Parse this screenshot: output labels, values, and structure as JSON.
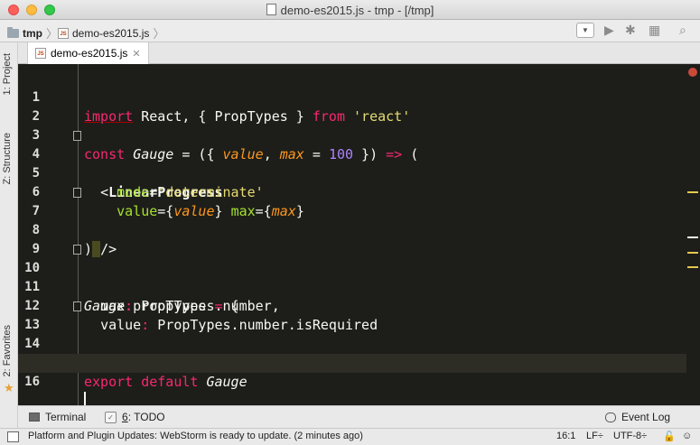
{
  "window": {
    "title": "demo-es2015.js - tmp - [/tmp]"
  },
  "breadcrumbs": [
    {
      "label": "tmp"
    },
    {
      "label": "demo-es2015.js"
    }
  ],
  "editor_tabs": [
    {
      "label": "demo-es2015.js",
      "active": true
    }
  ],
  "sidebar": {
    "tabs": [
      "1: Project",
      "Z: Structure",
      "2: Favorites"
    ]
  },
  "toolbar": {
    "icons": [
      "dropdown-icon",
      "run-icon",
      "debug-icon",
      "coverage-icon",
      "search-icon"
    ]
  },
  "editor": {
    "lines": [
      {
        "num": "1"
      },
      {
        "num": "2"
      },
      {
        "num": "3"
      },
      {
        "num": "4"
      },
      {
        "num": "5"
      },
      {
        "num": "6"
      },
      {
        "num": "7"
      },
      {
        "num": "8"
      },
      {
        "num": "9"
      },
      {
        "num": "10"
      },
      {
        "num": "11"
      },
      {
        "num": "12"
      },
      {
        "num": "13"
      },
      {
        "num": "14"
      },
      {
        "num": "15"
      },
      {
        "num": "16"
      }
    ],
    "code": {
      "l1_import": "import",
      "l1_rest": " React, { PropTypes } ",
      "l1_from": "from",
      "l1_str": "'react'",
      "l3_const": "const",
      "l3_name": "Gauge",
      "l3_eq": " = ({ ",
      "l3_value": "value",
      "l3_comma": ", ",
      "l3_max": "max",
      "l3_eq2": " = ",
      "l3_num": "100",
      "l3_end": " }) ",
      "l3_arrow": "=>",
      "l3_paren": " (",
      "l4_open": "<",
      "l4_tag": "LinearProgress",
      "l5_attr": "mode",
      "l5_eq": "=",
      "l5_str": "'determinate'",
      "l6_attr": "value",
      "l6_open": "={",
      "l6_val": "value",
      "l6_close": "} ",
      "l6_attr2": "max",
      "l6_open2": "={",
      "l6_val2": "max",
      "l6_close2": "}",
      "l7": "/>",
      "l8": ")",
      "l10_name": "Gauge",
      "l10_rest": ".propTypes ",
      "l10_eq": "=",
      "l10_brace": " {",
      "l11_key": "max",
      "l11_colon": ": ",
      "l11_val": "PropTypes.number,",
      "l12_key": "value",
      "l12_colon": ": ",
      "l12_val": "PropTypes.number.isRequired",
      "l13": "}",
      "l15_export": "export",
      "l15_default": "default",
      "l15_name": "Gauge"
    }
  },
  "toolwindows": {
    "terminal": "Terminal",
    "todo_num": "6",
    "todo_label": ": TODO",
    "event_log": "Event Log"
  },
  "status": {
    "message": "Platform and Plugin Updates: WebStorm is ready to update. (2 minutes ago)",
    "position": "16:1",
    "line_sep": "LF÷",
    "encoding": "UTF-8÷"
  },
  "colors": {
    "editor_bg": "#1d1e19",
    "keyword": "#f92672",
    "string": "#e6db74",
    "number": "#ae81ff",
    "param": "#fd971f",
    "attribute": "#a6e22e"
  }
}
